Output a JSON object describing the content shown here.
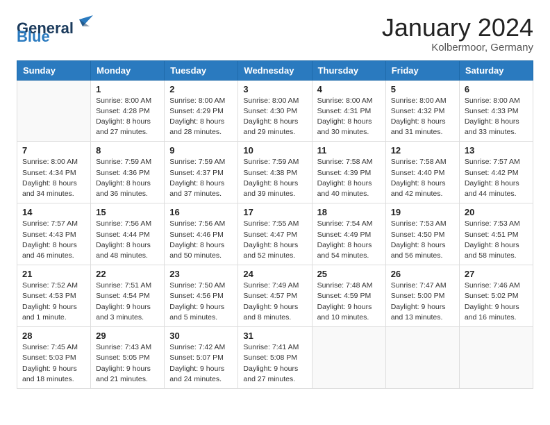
{
  "logo": {
    "general": "General",
    "blue": "Blue"
  },
  "title": "January 2024",
  "location": "Kolbermoor, Germany",
  "weekdays": [
    "Sunday",
    "Monday",
    "Tuesday",
    "Wednesday",
    "Thursday",
    "Friday",
    "Saturday"
  ],
  "weeks": [
    [
      {
        "day": "",
        "info": ""
      },
      {
        "day": "1",
        "info": "Sunrise: 8:00 AM\nSunset: 4:28 PM\nDaylight: 8 hours\nand 27 minutes."
      },
      {
        "day": "2",
        "info": "Sunrise: 8:00 AM\nSunset: 4:29 PM\nDaylight: 8 hours\nand 28 minutes."
      },
      {
        "day": "3",
        "info": "Sunrise: 8:00 AM\nSunset: 4:30 PM\nDaylight: 8 hours\nand 29 minutes."
      },
      {
        "day": "4",
        "info": "Sunrise: 8:00 AM\nSunset: 4:31 PM\nDaylight: 8 hours\nand 30 minutes."
      },
      {
        "day": "5",
        "info": "Sunrise: 8:00 AM\nSunset: 4:32 PM\nDaylight: 8 hours\nand 31 minutes."
      },
      {
        "day": "6",
        "info": "Sunrise: 8:00 AM\nSunset: 4:33 PM\nDaylight: 8 hours\nand 33 minutes."
      }
    ],
    [
      {
        "day": "7",
        "info": "Sunrise: 8:00 AM\nSunset: 4:34 PM\nDaylight: 8 hours\nand 34 minutes."
      },
      {
        "day": "8",
        "info": "Sunrise: 7:59 AM\nSunset: 4:36 PM\nDaylight: 8 hours\nand 36 minutes."
      },
      {
        "day": "9",
        "info": "Sunrise: 7:59 AM\nSunset: 4:37 PM\nDaylight: 8 hours\nand 37 minutes."
      },
      {
        "day": "10",
        "info": "Sunrise: 7:59 AM\nSunset: 4:38 PM\nDaylight: 8 hours\nand 39 minutes."
      },
      {
        "day": "11",
        "info": "Sunrise: 7:58 AM\nSunset: 4:39 PM\nDaylight: 8 hours\nand 40 minutes."
      },
      {
        "day": "12",
        "info": "Sunrise: 7:58 AM\nSunset: 4:40 PM\nDaylight: 8 hours\nand 42 minutes."
      },
      {
        "day": "13",
        "info": "Sunrise: 7:57 AM\nSunset: 4:42 PM\nDaylight: 8 hours\nand 44 minutes."
      }
    ],
    [
      {
        "day": "14",
        "info": "Sunrise: 7:57 AM\nSunset: 4:43 PM\nDaylight: 8 hours\nand 46 minutes."
      },
      {
        "day": "15",
        "info": "Sunrise: 7:56 AM\nSunset: 4:44 PM\nDaylight: 8 hours\nand 48 minutes."
      },
      {
        "day": "16",
        "info": "Sunrise: 7:56 AM\nSunset: 4:46 PM\nDaylight: 8 hours\nand 50 minutes."
      },
      {
        "day": "17",
        "info": "Sunrise: 7:55 AM\nSunset: 4:47 PM\nDaylight: 8 hours\nand 52 minutes."
      },
      {
        "day": "18",
        "info": "Sunrise: 7:54 AM\nSunset: 4:49 PM\nDaylight: 8 hours\nand 54 minutes."
      },
      {
        "day": "19",
        "info": "Sunrise: 7:53 AM\nSunset: 4:50 PM\nDaylight: 8 hours\nand 56 minutes."
      },
      {
        "day": "20",
        "info": "Sunrise: 7:53 AM\nSunset: 4:51 PM\nDaylight: 8 hours\nand 58 minutes."
      }
    ],
    [
      {
        "day": "21",
        "info": "Sunrise: 7:52 AM\nSunset: 4:53 PM\nDaylight: 9 hours\nand 1 minute."
      },
      {
        "day": "22",
        "info": "Sunrise: 7:51 AM\nSunset: 4:54 PM\nDaylight: 9 hours\nand 3 minutes."
      },
      {
        "day": "23",
        "info": "Sunrise: 7:50 AM\nSunset: 4:56 PM\nDaylight: 9 hours\nand 5 minutes."
      },
      {
        "day": "24",
        "info": "Sunrise: 7:49 AM\nSunset: 4:57 PM\nDaylight: 9 hours\nand 8 minutes."
      },
      {
        "day": "25",
        "info": "Sunrise: 7:48 AM\nSunset: 4:59 PM\nDaylight: 9 hours\nand 10 minutes."
      },
      {
        "day": "26",
        "info": "Sunrise: 7:47 AM\nSunset: 5:00 PM\nDaylight: 9 hours\nand 13 minutes."
      },
      {
        "day": "27",
        "info": "Sunrise: 7:46 AM\nSunset: 5:02 PM\nDaylight: 9 hours\nand 16 minutes."
      }
    ],
    [
      {
        "day": "28",
        "info": "Sunrise: 7:45 AM\nSunset: 5:03 PM\nDaylight: 9 hours\nand 18 minutes."
      },
      {
        "day": "29",
        "info": "Sunrise: 7:43 AM\nSunset: 5:05 PM\nDaylight: 9 hours\nand 21 minutes."
      },
      {
        "day": "30",
        "info": "Sunrise: 7:42 AM\nSunset: 5:07 PM\nDaylight: 9 hours\nand 24 minutes."
      },
      {
        "day": "31",
        "info": "Sunrise: 7:41 AM\nSunset: 5:08 PM\nDaylight: 9 hours\nand 27 minutes."
      },
      {
        "day": "",
        "info": ""
      },
      {
        "day": "",
        "info": ""
      },
      {
        "day": "",
        "info": ""
      }
    ]
  ]
}
